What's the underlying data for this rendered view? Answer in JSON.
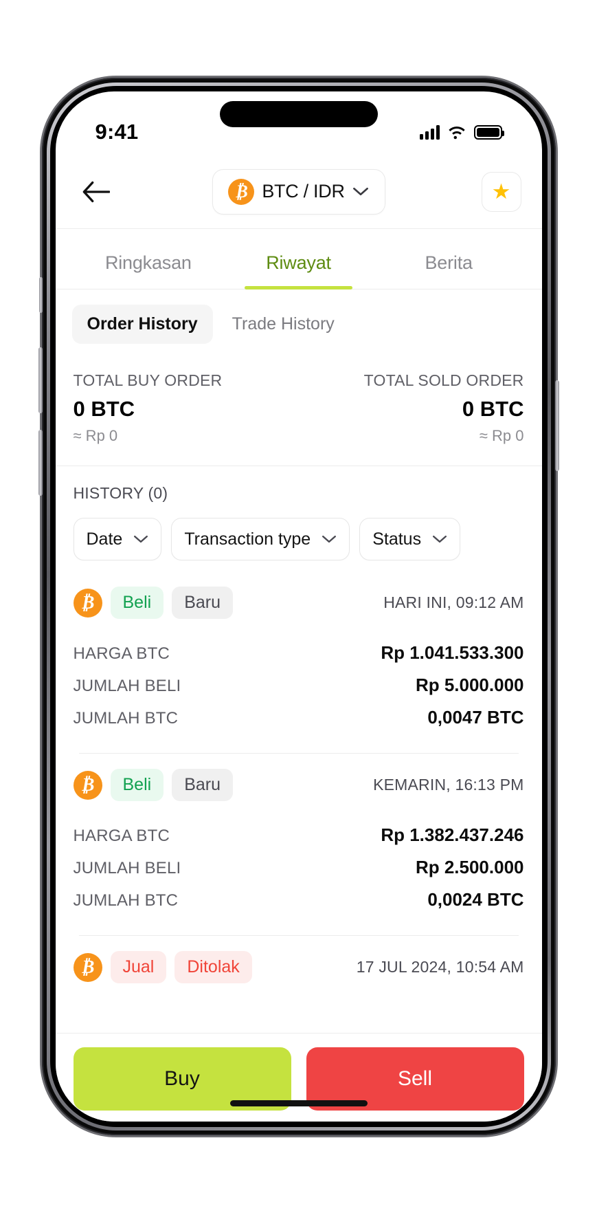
{
  "status_bar": {
    "time": "9:41",
    "signal_icon": "cellular-bars-icon",
    "wifi_icon": "wifi-icon",
    "battery_icon": "battery-full-icon"
  },
  "navbar": {
    "back_icon": "arrow-left-icon",
    "pair_label": "BTC / IDR",
    "pair_coin_icon": "bitcoin-icon",
    "pair_chevron_icon": "chevron-down-icon",
    "favorite_icon": "star-icon"
  },
  "main_tabs": [
    {
      "label": "Ringkasan",
      "active": false
    },
    {
      "label": "Riwayat",
      "active": true
    },
    {
      "label": "Berita",
      "active": false
    }
  ],
  "sub_tabs": [
    {
      "label": "Order History",
      "active": true
    },
    {
      "label": "Trade History",
      "active": false
    }
  ],
  "totals": {
    "buy": {
      "caption": "TOTAL BUY ORDER",
      "value": "0 BTC",
      "approx": "≈ Rp 0"
    },
    "sold": {
      "caption": "TOTAL SOLD ORDER",
      "value": "0 BTC",
      "approx": "≈ Rp 0"
    }
  },
  "history": {
    "heading": "HISTORY (0)",
    "filters": [
      {
        "label": "Date",
        "icon": "chevron-down-icon"
      },
      {
        "label": "Transaction type",
        "icon": "chevron-down-icon"
      },
      {
        "label": "Status",
        "icon": "chevron-down-icon"
      }
    ],
    "transactions": [
      {
        "coin_icon": "bitcoin-icon",
        "type_label": "Beli",
        "type_kind": "buy",
        "status_label": "Baru",
        "status_kind": "neutral",
        "time": "HARI INI, 09:12 AM",
        "rows": [
          {
            "key": "HARGA BTC",
            "value": "Rp 1.041.533.300"
          },
          {
            "key": "JUMLAH BELI",
            "value": "Rp 5.000.000"
          },
          {
            "key": "JUMLAH BTC",
            "value": "0,0047 BTC"
          }
        ]
      },
      {
        "coin_icon": "bitcoin-icon",
        "type_label": "Beli",
        "type_kind": "buy",
        "status_label": "Baru",
        "status_kind": "neutral",
        "time": "KEMARIN, 16:13 PM",
        "rows": [
          {
            "key": "HARGA BTC",
            "value": "Rp 1.382.437.246"
          },
          {
            "key": "JUMLAH BELI",
            "value": "Rp 2.500.000"
          },
          {
            "key": "JUMLAH BTC",
            "value": "0,0024 BTC"
          }
        ]
      },
      {
        "coin_icon": "bitcoin-icon",
        "type_label": "Jual",
        "type_kind": "sell",
        "status_label": "Ditolak",
        "status_kind": "reject",
        "time": "17 JUL 2024, 10:54 AM",
        "rows": []
      }
    ]
  },
  "action_bar": {
    "buy_label": "Buy",
    "sell_label": "Sell"
  },
  "colors": {
    "brand_lime": "#c5e23f",
    "active_tab_text": "#5e8c12",
    "sell_red": "#ef4444",
    "buy_green": "#12a150",
    "bitcoin_orange": "#f7931a",
    "star_yellow": "#ffc107"
  }
}
